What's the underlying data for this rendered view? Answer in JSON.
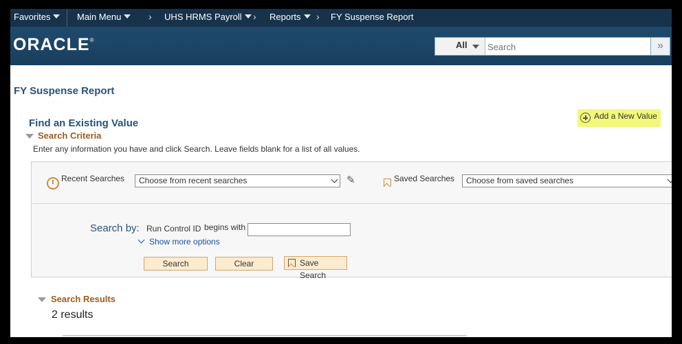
{
  "nav": {
    "favorites": "Favorites",
    "main_menu": "Main Menu",
    "breadcrumbs": [
      "UHS HRMS Payroll",
      "Reports",
      "FY Suspense Report"
    ]
  },
  "header": {
    "logo_text": "ORACLE",
    "logo_mark": "®",
    "search_scope": "All",
    "search_placeholder": "Search"
  },
  "page": {
    "title": "FY Suspense Report",
    "find_heading": "Find an Existing Value",
    "add_new_label": "Add a New Value",
    "search_criteria_label": "Search Criteria",
    "instructions": "Enter any information you have and click Search. Leave fields blank for a list of all values.",
    "recent_searches_label": "Recent Searches",
    "recent_searches_value": "Choose from recent searches",
    "saved_searches_label": "Saved Searches",
    "saved_searches_value": "Choose from saved searches",
    "search_by_label": "Search by:",
    "field_label": "Run Control ID",
    "operator": "begins with",
    "field_value": "",
    "show_more": "Show more options",
    "buttons": {
      "search": "Search",
      "clear": "Clear",
      "save_search": "Save Search"
    },
    "results_label": "Search Results",
    "results_count": "2 results"
  },
  "colors": {
    "nav_bg": "#17324b",
    "banner_bg": "#1f4a6c",
    "heading_blue": "#27527b",
    "section_brown": "#9c5d1f",
    "highlight_yellow": "#f3f87a",
    "button_bg": "#fcebcf"
  }
}
